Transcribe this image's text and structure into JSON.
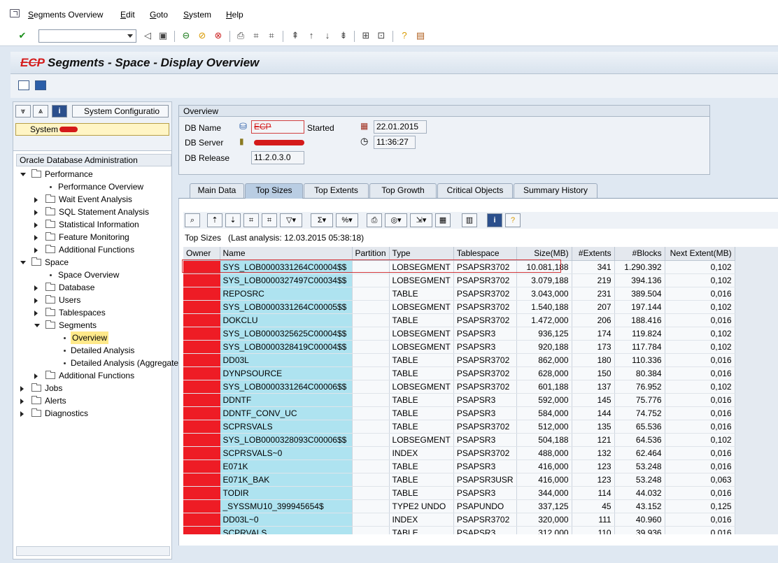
{
  "menu": {
    "items": [
      {
        "u": "S",
        "rest": "egments Overview"
      },
      {
        "u": "E",
        "rest": "dit"
      },
      {
        "u": "G",
        "rest": "oto"
      },
      {
        "u": "S",
        "rest": "ystem"
      },
      {
        "u": "H",
        "rest": "elp"
      }
    ]
  },
  "title": {
    "redacted_prefix": "ECP",
    "text": " Segments - Space - Display Overview"
  },
  "left": {
    "sys_config": "System Configuratio",
    "system_label": "System",
    "tree_header": "Oracle Database Administration",
    "tree": [
      {
        "label": "Performance",
        "level": 0,
        "kind": "folder",
        "open": true
      },
      {
        "label": "Performance Overview",
        "level": 1,
        "kind": "leaf"
      },
      {
        "label": "Wait Event Analysis",
        "level": 1,
        "kind": "folder",
        "open": false
      },
      {
        "label": "SQL Statement Analysis",
        "level": 1,
        "kind": "folder",
        "open": false
      },
      {
        "label": "Statistical Information",
        "level": 1,
        "kind": "folder",
        "open": false
      },
      {
        "label": "Feature Monitoring",
        "level": 1,
        "kind": "folder",
        "open": false
      },
      {
        "label": "Additional Functions",
        "level": 1,
        "kind": "folder",
        "open": false
      },
      {
        "label": "Space",
        "level": 0,
        "kind": "folder",
        "open": true
      },
      {
        "label": "Space Overview",
        "level": 1,
        "kind": "leaf"
      },
      {
        "label": "Database",
        "level": 1,
        "kind": "folder",
        "open": false
      },
      {
        "label": "Users",
        "level": 1,
        "kind": "folder",
        "open": false
      },
      {
        "label": "Tablespaces",
        "level": 1,
        "kind": "folder",
        "open": false
      },
      {
        "label": "Segments",
        "level": 1,
        "kind": "folder",
        "open": true
      },
      {
        "label": "Overview",
        "level": 2,
        "kind": "leaf",
        "selected": true
      },
      {
        "label": "Detailed Analysis",
        "level": 2,
        "kind": "leaf"
      },
      {
        "label": "Detailed Analysis (Aggregated",
        "level": 2,
        "kind": "leaf"
      },
      {
        "label": "Additional Functions",
        "level": 1,
        "kind": "folder",
        "open": false
      },
      {
        "label": "Jobs",
        "level": 0,
        "kind": "folder",
        "open": false
      },
      {
        "label": "Alerts",
        "level": 0,
        "kind": "folder",
        "open": false
      },
      {
        "label": "Diagnostics",
        "level": 0,
        "kind": "folder",
        "open": false
      }
    ]
  },
  "overview": {
    "legend": "Overview",
    "db_name_label": "DB Name",
    "db_name_value": "ECP",
    "started_label": "Started",
    "started_date": "22.01.2015",
    "started_time": "11:36:27",
    "db_server_label": "DB Server",
    "db_release_label": "DB Release",
    "db_release_value": "11.2.0.3.0"
  },
  "tabs": [
    {
      "label": "Main Data",
      "active": false
    },
    {
      "label": "Top Sizes",
      "active": true
    },
    {
      "label": "Top Extents",
      "active": false
    },
    {
      "label": "Top Growth",
      "active": false
    },
    {
      "label": "Critical Objects",
      "active": false
    },
    {
      "label": "Summary History",
      "active": false
    }
  ],
  "grid": {
    "caption_label": "Top Sizes",
    "caption_analysis": "(Last analysis: 12.03.2015 05:38:18)",
    "columns": [
      "Owner",
      "Name",
      "Partition",
      "Type",
      "Tablespace",
      "Size(MB)",
      "#Extents",
      "#Blocks",
      "Next Extent(MB)"
    ],
    "rows": [
      [
        "",
        "SYS_LOB0000331264C00004$$",
        "",
        "LOBSEGMENT",
        "PSAPSR3702",
        "10.081,188",
        "341",
        "1.290.392",
        "0,102"
      ],
      [
        "",
        "SYS_LOB0000327497C00034$$",
        "",
        "LOBSEGMENT",
        "PSAPSR3702",
        "3.079,188",
        "219",
        "394.136",
        "0,102"
      ],
      [
        "",
        "REPOSRC",
        "",
        "TABLE",
        "PSAPSR3702",
        "3.043,000",
        "231",
        "389.504",
        "0,016"
      ],
      [
        "",
        "SYS_LOB0000331264C00005$$",
        "",
        "LOBSEGMENT",
        "PSAPSR3702",
        "1.540,188",
        "207",
        "197.144",
        "0,102"
      ],
      [
        "",
        "DOKCLU",
        "",
        "TABLE",
        "PSAPSR3702",
        "1.472,000",
        "206",
        "188.416",
        "0,016"
      ],
      [
        "",
        "SYS_LOB0000325625C00004$$",
        "",
        "LOBSEGMENT",
        "PSAPSR3",
        "936,125",
        "174",
        "119.824",
        "0,102"
      ],
      [
        "",
        "SYS_LOB0000328419C00004$$",
        "",
        "LOBSEGMENT",
        "PSAPSR3",
        "920,188",
        "173",
        "117.784",
        "0,102"
      ],
      [
        "",
        "DD03L",
        "",
        "TABLE",
        "PSAPSR3702",
        "862,000",
        "180",
        "110.336",
        "0,016"
      ],
      [
        "",
        "DYNPSOURCE",
        "",
        "TABLE",
        "PSAPSR3702",
        "628,000",
        "150",
        "80.384",
        "0,016"
      ],
      [
        "",
        "SYS_LOB0000331264C00006$$",
        "",
        "LOBSEGMENT",
        "PSAPSR3702",
        "601,188",
        "137",
        "76.952",
        "0,102"
      ],
      [
        "",
        "DDNTF",
        "",
        "TABLE",
        "PSAPSR3",
        "592,000",
        "145",
        "75.776",
        "0,016"
      ],
      [
        "",
        "DDNTF_CONV_UC",
        "",
        "TABLE",
        "PSAPSR3",
        "584,000",
        "144",
        "74.752",
        "0,016"
      ],
      [
        "",
        "SCPRSVALS",
        "",
        "TABLE",
        "PSAPSR3702",
        "512,000",
        "135",
        "65.536",
        "0,016"
      ],
      [
        "",
        "SYS_LOB0000328093C00006$$",
        "",
        "LOBSEGMENT",
        "PSAPSR3",
        "504,188",
        "121",
        "64.536",
        "0,102"
      ],
      [
        "",
        "SCPRSVALS~0",
        "",
        "INDEX",
        "PSAPSR3702",
        "488,000",
        "132",
        "62.464",
        "0,016"
      ],
      [
        "",
        "E071K",
        "",
        "TABLE",
        "PSAPSR3",
        "416,000",
        "123",
        "53.248",
        "0,016"
      ],
      [
        "",
        "E071K_BAK",
        "",
        "TABLE",
        "PSAPSR3USR",
        "416,000",
        "123",
        "53.248",
        "0,063"
      ],
      [
        "",
        "TODIR",
        "",
        "TABLE",
        "PSAPSR3",
        "344,000",
        "114",
        "44.032",
        "0,016"
      ],
      [
        "",
        "_SYSSMU10_399945654$",
        "",
        "TYPE2 UNDO",
        "PSAPUNDO",
        "337,125",
        "45",
        "43.152",
        "0,125"
      ],
      [
        "",
        "DD03L~0",
        "",
        "INDEX",
        "PSAPSR3702",
        "320,000",
        "111",
        "40.960",
        "0,016"
      ],
      [
        "",
        "SCPRVALS",
        "",
        "TABLE",
        "PSAPSR3",
        "312,000",
        "110",
        "39.936",
        "0,016"
      ]
    ]
  }
}
